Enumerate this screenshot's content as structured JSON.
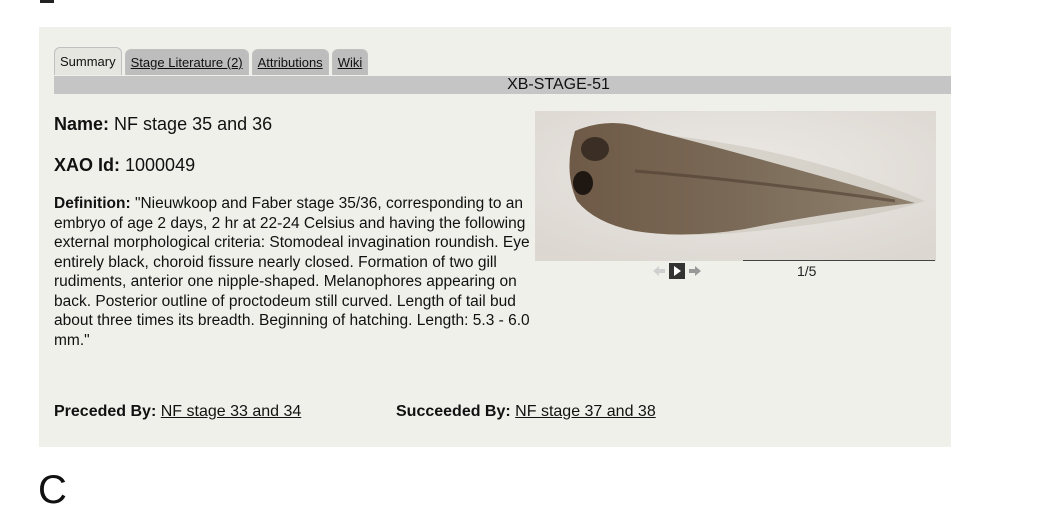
{
  "tabs": [
    {
      "label": "Summary",
      "active": true
    },
    {
      "label": "Stage Literature (2)",
      "active": false
    },
    {
      "label": "Attributions",
      "active": false
    },
    {
      "label": "Wiki",
      "active": false
    }
  ],
  "stage_id": "XB-STAGE-51",
  "name": {
    "label": "Name:",
    "value": "NF stage 35 and 36"
  },
  "xao": {
    "label": "XAO Id:",
    "value": "1000049"
  },
  "definition": {
    "label": "Definition:",
    "value": "\"Nieuwkoop and Faber stage 35/36, corresponding to an embryo of age 2 days, 2 hr at 22-24 Celsius and having the following external morphological criteria: Stomodeal invagination roundish. Eye entirely black, choroid fissure nearly closed. Formation of two gill rudiments, anterior one nipple-shaped. Melanophores appearing on back. Posterior outline of proctodeum still curved. Length of tail bud about three times its breadth. Beginning of hatching. Length: 5.3 - 6.0 mm.\""
  },
  "preceded": {
    "label": "Preceded By:",
    "link": "NF stage 33 and 34"
  },
  "succeeded": {
    "label": "Succeeded By:",
    "link": "NF stage 37 and 38"
  },
  "carousel": {
    "counter": "1/5",
    "icons": [
      "prev-arrow-icon",
      "play-icon",
      "next-arrow-icon"
    ]
  },
  "panel_letter": "C",
  "colors": {
    "panel_bg": "#f0f0eb",
    "tab_bg": "#bdbdbd",
    "bar_bg": "#c5c5c5"
  }
}
